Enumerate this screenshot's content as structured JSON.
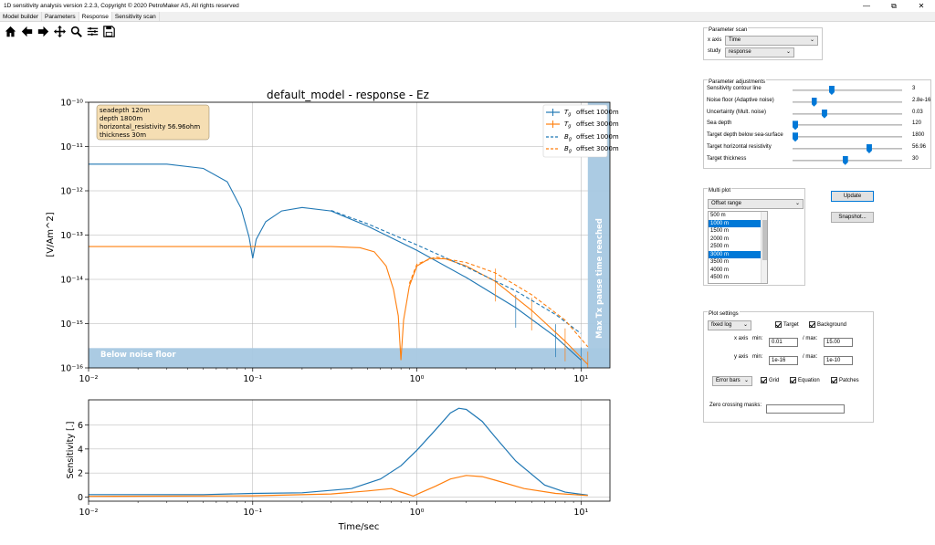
{
  "window": {
    "title": "1D sensitivity analysis version 2.2.3, Copyright © 2020 PetroMaker AS, All rights reserved",
    "controls": [
      "—",
      "⧉",
      "✕"
    ]
  },
  "tabs": [
    {
      "label": "Model builder",
      "active": false
    },
    {
      "label": "Parameters",
      "active": false
    },
    {
      "label": "Response",
      "active": true
    },
    {
      "label": "Sensitivity scan",
      "active": false
    }
  ],
  "toolbar": {
    "icons": [
      "home-icon",
      "back-arrow-icon",
      "forward-arrow-icon",
      "pan-icon",
      "zoom-icon",
      "configure-subplots-icon",
      "save-icon"
    ]
  },
  "colors": {
    "blue": "#1f77b4",
    "orange": "#ff7f0e",
    "patch": "#a6c8e2",
    "annotation_bg": "#f5deb3",
    "accent": "#0078d7"
  },
  "chart_data": [
    {
      "type": "line",
      "title": "default_model - response - Ez",
      "xlabel": "",
      "ylabel": "[V/Am^2]",
      "xscale": "log",
      "yscale": "log",
      "xlim": [
        0.01,
        15
      ],
      "ylim": [
        1e-16,
        1e-10
      ],
      "grid": true,
      "x_tick_labels": [
        "10⁻²",
        "10⁻¹",
        "10⁰",
        "10¹"
      ],
      "y_tick_labels": [
        "10⁻¹⁶",
        "10⁻¹⁵",
        "10⁻¹⁴",
        "10⁻¹³",
        "10⁻¹²",
        "10⁻¹¹",
        "10⁻¹⁰"
      ],
      "annotation": [
        "seadepth 120m",
        "depth 1800m",
        "horizontal_resistivity 56.96ohm",
        "thickness 30m"
      ],
      "patches": {
        "noise_floor_label": "Below noise floor",
        "noise_floor_y": 2.8e-16,
        "max_tx_label": "Max Tx pause time reached",
        "max_tx_x": 11
      },
      "legend_placement": "top-right",
      "legend": [
        {
          "symbol": "T",
          "sub": "g",
          "text": "offset 1000m",
          "color": "blue",
          "style": "solid"
        },
        {
          "symbol": "T",
          "sub": "g",
          "text": "offset 3000m",
          "color": "orange",
          "style": "solid"
        },
        {
          "symbol": "B",
          "sub": "g",
          "text": "offset 1000m",
          "color": "blue",
          "style": "dashed"
        },
        {
          "symbol": "B",
          "sub": "g",
          "text": "offset 3000m",
          "color": "orange",
          "style": "dashed"
        }
      ],
      "series": [
        {
          "color": "blue",
          "style": "solid",
          "points": [
            [
              0.01,
              4e-12
            ],
            [
              0.03,
              4e-12
            ],
            [
              0.05,
              3.2e-12
            ],
            [
              0.07,
              1.6e-12
            ],
            [
              0.085,
              4e-13
            ],
            [
              0.095,
              9e-14
            ],
            [
              0.1,
              3e-14
            ],
            [
              0.105,
              8e-14
            ],
            [
              0.12,
              2e-13
            ],
            [
              0.15,
              3.5e-13
            ],
            [
              0.2,
              4.2e-13
            ],
            [
              0.3,
              3.5e-13
            ],
            [
              0.5,
              1.6e-13
            ],
            [
              1,
              4.5e-14
            ],
            [
              2,
              1.1e-14
            ],
            [
              4,
              2.3e-15
            ],
            [
              7,
              5e-16
            ],
            [
              10,
              1.5e-16
            ]
          ]
        },
        {
          "color": "orange",
          "style": "solid",
          "points": [
            [
              0.01,
              5.5e-14
            ],
            [
              0.3,
              5.5e-14
            ],
            [
              0.45,
              5.2e-14
            ],
            [
              0.55,
              4.2e-14
            ],
            [
              0.65,
              2e-14
            ],
            [
              0.72,
              6e-15
            ],
            [
              0.77,
              1.5e-15
            ],
            [
              0.8,
              1.5e-16
            ],
            [
              0.83,
              1.2e-15
            ],
            [
              0.9,
              7e-15
            ],
            [
              1,
              2e-14
            ],
            [
              1.2,
              3e-14
            ],
            [
              1.5,
              2.9e-14
            ],
            [
              2,
              2e-14
            ],
            [
              3,
              9e-15
            ],
            [
              5,
              2e-15
            ],
            [
              8,
              4e-16
            ],
            [
              11,
              1.2e-16
            ]
          ]
        },
        {
          "color": "blue",
          "style": "dashed",
          "points": [
            [
              0.3,
              3.6e-13
            ],
            [
              0.5,
              1.8e-13
            ],
            [
              1,
              6e-14
            ],
            [
              2,
              1.9e-14
            ],
            [
              4,
              5.5e-15
            ],
            [
              7,
              1.6e-15
            ],
            [
              10,
              6e-16
            ]
          ]
        },
        {
          "color": "orange",
          "style": "dashed",
          "points": [
            [
              0.9,
              8e-15
            ],
            [
              1,
              2.2e-14
            ],
            [
              1.3,
              3.2e-14
            ],
            [
              2,
              2.4e-14
            ],
            [
              3,
              1.4e-14
            ],
            [
              5,
              4.5e-15
            ],
            [
              8,
              1.2e-15
            ],
            [
              11,
              3e-16
            ]
          ]
        }
      ]
    },
    {
      "type": "line",
      "title": "",
      "xlabel": "Time/sec",
      "ylabel": "Sensitivity [.]",
      "xscale": "log",
      "xlim": [
        0.01,
        15
      ],
      "ylim": [
        -0.35,
        8.1
      ],
      "grid": true,
      "x_tick_labels": [
        "10⁻²",
        "10⁻¹",
        "10⁰",
        "10¹"
      ],
      "y_ticks": [
        0,
        2,
        4,
        6
      ],
      "series": [
        {
          "color": "blue",
          "style": "solid",
          "points": [
            [
              0.01,
              0.2
            ],
            [
              0.05,
              0.2
            ],
            [
              0.1,
              0.3
            ],
            [
              0.2,
              0.35
            ],
            [
              0.4,
              0.7
            ],
            [
              0.6,
              1.5
            ],
            [
              0.8,
              2.6
            ],
            [
              1,
              3.9
            ],
            [
              1.3,
              5.6
            ],
            [
              1.6,
              7.0
            ],
            [
              1.8,
              7.4
            ],
            [
              2.0,
              7.3
            ],
            [
              2.5,
              6.3
            ],
            [
              3,
              5.0
            ],
            [
              4,
              3.0
            ],
            [
              6,
              1.0
            ],
            [
              8,
              0.4
            ],
            [
              11,
              0.15
            ]
          ]
        },
        {
          "color": "orange",
          "style": "solid",
          "points": [
            [
              0.01,
              0.05
            ],
            [
              0.1,
              0.1
            ],
            [
              0.3,
              0.25
            ],
            [
              0.5,
              0.5
            ],
            [
              0.7,
              0.7
            ],
            [
              0.78,
              0.45
            ],
            [
              0.85,
              0.3
            ],
            [
              0.95,
              0.08
            ],
            [
              1.05,
              0.35
            ],
            [
              1.3,
              0.9
            ],
            [
              1.6,
              1.5
            ],
            [
              2,
              1.8
            ],
            [
              2.5,
              1.7
            ],
            [
              3,
              1.4
            ],
            [
              4.5,
              0.7
            ],
            [
              7,
              0.3
            ],
            [
              11,
              0.12
            ]
          ]
        }
      ]
    }
  ],
  "panel": {
    "parameter_scan": {
      "title": "Parameter scan",
      "x_axis_label": "x axis",
      "x_axis_value": "Time",
      "study_label": "study",
      "study_value": "response"
    },
    "parameter_adjustments": {
      "title": "Parameter adjustments",
      "sliders": [
        {
          "label": "Sensitivity contour line",
          "value": "3",
          "pos": 0.35
        },
        {
          "label": "Noise floor (Adaptive noise)",
          "value": "2.8e-16",
          "pos": 0.18
        },
        {
          "label": "Uncertainty (Mult. noise)",
          "value": "0.03",
          "pos": 0.28
        },
        {
          "label": "Sea depth",
          "value": "120",
          "pos": 0.0
        },
        {
          "label": "Target depth below sea-surface",
          "value": "1800",
          "pos": 0.0
        },
        {
          "label": "Target horizontal resistivity",
          "value": "56.96",
          "pos": 0.71
        },
        {
          "label": "Target thickness",
          "value": "30",
          "pos": 0.48
        }
      ]
    },
    "multi_plot": {
      "title": "Multi plot",
      "selector": "Offset range",
      "items": [
        {
          "label": "500 m",
          "selected": false
        },
        {
          "label": "1000 m",
          "selected": true
        },
        {
          "label": "1500 m",
          "selected": false
        },
        {
          "label": "2000 m",
          "selected": false
        },
        {
          "label": "2500 m",
          "selected": false
        },
        {
          "label": "3000 m",
          "selected": true
        },
        {
          "label": "3500 m",
          "selected": false
        },
        {
          "label": "4000 m",
          "selected": false
        },
        {
          "label": "4500 m",
          "selected": false
        },
        {
          "label": "5000 m",
          "selected": false
        }
      ]
    },
    "buttons": {
      "update": "Update",
      "snapshot": "Snapshot..."
    },
    "plot_settings": {
      "title": "Plot settings",
      "scale_mode": "fixed log",
      "target_label": "Target",
      "background_label": "Background",
      "x_axis_label": "x axis",
      "min_label": "min:",
      "max_label": "/ max:",
      "x_min": "0.01",
      "x_max": "15.00",
      "y_axis_label": "y axis",
      "y_min": "1e-16",
      "y_max": "1e-10",
      "error_mode": "Error bars",
      "grid_label": "Grid",
      "equation_label": "Equation",
      "patches_label": "Patches",
      "zero_crossing_label": "Zero crossing masks:",
      "zero_crossing_value": ""
    }
  }
}
